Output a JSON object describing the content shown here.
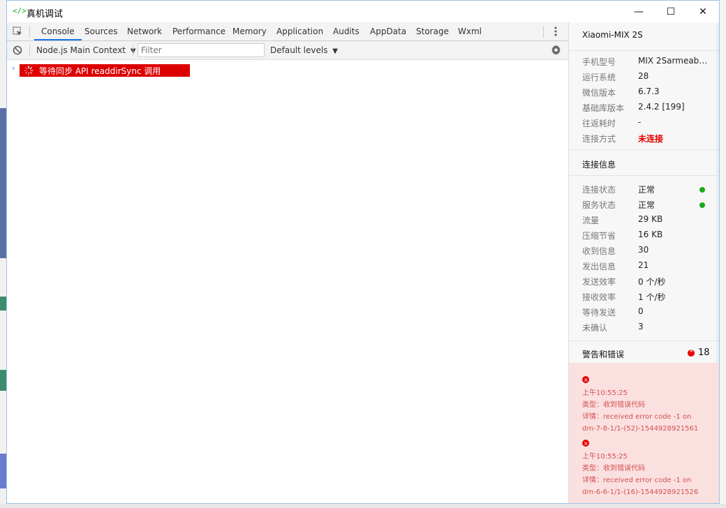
{
  "window": {
    "title": "真机调试",
    "app_icon": "</>",
    "min_glyph": "—",
    "max_glyph": "☐",
    "close_glyph": "✕"
  },
  "devtools": {
    "tabs": [
      "Console",
      "Sources",
      "Network",
      "Performance",
      "Memory",
      "Application",
      "Audits",
      "AppData",
      "Storage",
      "Wxml"
    ],
    "active_tab": "Console",
    "context": "Node.js Main Context",
    "filter_placeholder": "Filter",
    "levels": "Default levels",
    "dropdown_glyph": "▼"
  },
  "console": {
    "prompt": "›",
    "messages": [
      {
        "text": "等待同步 API readdirSync 调用",
        "icon": "spinner-icon",
        "color": "#dd0000"
      }
    ]
  },
  "panel": {
    "device": "Xiaomi-MIX 2S",
    "device_info": [
      {
        "label": "手机型号",
        "value": "MIX 2Sarmeabi-..."
      },
      {
        "label": "运行系统",
        "value": "28"
      },
      {
        "label": "微信版本",
        "value": "6.7.3"
      },
      {
        "label": "基础库版本",
        "value": "2.4.2 [199]"
      },
      {
        "label": "往返耗时",
        "value": "-"
      },
      {
        "label": "连接方式",
        "value": "未连接"
      }
    ],
    "conn_title": "连接信息",
    "conn_info": [
      {
        "label": "连接状态",
        "value": "正常"
      },
      {
        "label": "服务状态",
        "value": "正常"
      },
      {
        "label": "流量",
        "value": "29 KB"
      },
      {
        "label": "压缩节省",
        "value": "16 KB"
      },
      {
        "label": "收到信息",
        "value": "30"
      },
      {
        "label": "发出信息",
        "value": "21"
      },
      {
        "label": "发送效率",
        "value": "0 个/秒"
      },
      {
        "label": "接收效率",
        "value": "1 个/秒"
      },
      {
        "label": "等待发送",
        "value": "0"
      },
      {
        "label": "未确认",
        "value": "3"
      }
    ],
    "warn_title": "警告和错误",
    "warn_count": "18",
    "errors": [
      {
        "time": "上午10:55:25",
        "type": "类型：收到错误代码",
        "detail1": "详情：received error code -1 on",
        "detail2": "dm-7-8-1/1-(52)-1544928921561"
      },
      {
        "time": "上午10:55:25",
        "type": "类型：收到错误代码",
        "detail1": "详情：received error code -1 on",
        "detail2": "dm-6-6-1/1-(16)-1544928921526"
      }
    ]
  },
  "colors": {
    "accent": "#1a73e8",
    "error_bg": "#dd0000",
    "status_ok": "#1aad19",
    "error_panel_bg": "#fbe0e0"
  }
}
